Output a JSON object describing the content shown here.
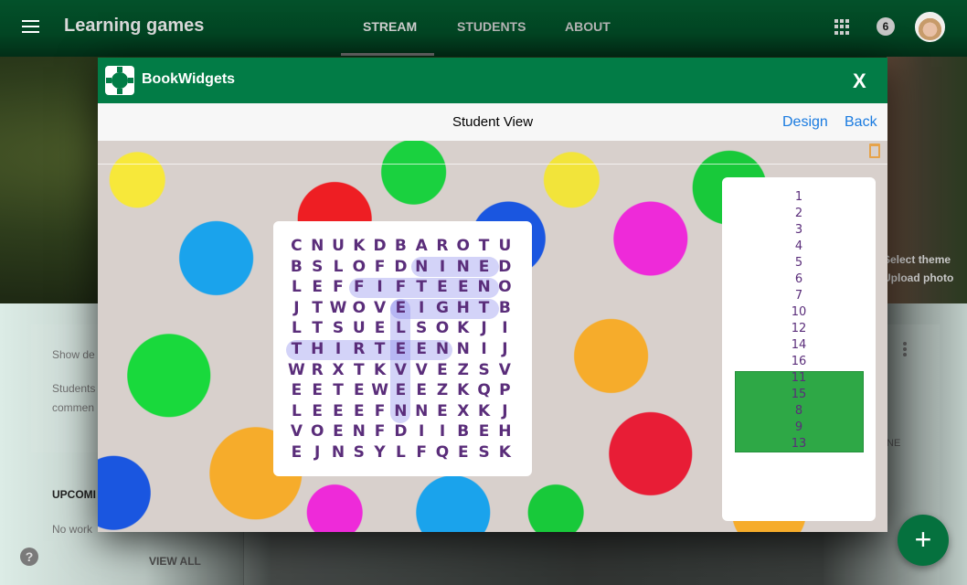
{
  "topbar": {
    "title": "Learning games",
    "tabs": [
      {
        "label": "STREAM",
        "active": true
      },
      {
        "label": "STUDENTS",
        "active": false
      },
      {
        "label": "ABOUT",
        "active": false
      }
    ],
    "notification_count": "6",
    "icons": {
      "menu": "hamburger-icon",
      "apps": "apps-grid-icon",
      "account": "avatar"
    }
  },
  "hero": {
    "select_theme": "Select theme",
    "upload_photo": "Upload photo"
  },
  "sidebar": {
    "show_deleted": "Show de",
    "students_line1": "Students",
    "students_line2": "commen",
    "upcoming_title": "UPCOMI",
    "no_work": "No work",
    "view_all": "VIEW ALL"
  },
  "stream": {
    "ne_label": "NE",
    "fab_label": "+"
  },
  "help": {
    "label": "?"
  },
  "modal": {
    "brand": "BookWidgets",
    "close_label": "X",
    "subbar_title": "Student View",
    "design_link": "Design",
    "back_link": "Back",
    "accent_color": "#027c46",
    "found_color": "#2ea846",
    "letter_color": "#5a2d7a"
  },
  "word_search": {
    "rows": [
      [
        "C",
        "N",
        "U",
        "K",
        "D",
        "B",
        "A",
        "R",
        "O",
        "T",
        "U"
      ],
      [
        "B",
        "S",
        "L",
        "O",
        "F",
        "D",
        "N",
        "I",
        "N",
        "E",
        "D"
      ],
      [
        "L",
        "E",
        "F",
        "F",
        "I",
        "F",
        "T",
        "E",
        "E",
        "N",
        "O"
      ],
      [
        "J",
        "T",
        "W",
        "O",
        "V",
        "E",
        "I",
        "G",
        "H",
        "T",
        "B"
      ],
      [
        "L",
        "T",
        "S",
        "U",
        "E",
        "L",
        "S",
        "O",
        "K",
        "J",
        "I"
      ],
      [
        "T",
        "H",
        "I",
        "R",
        "T",
        "E",
        "E",
        "N",
        "N",
        "I",
        "J"
      ],
      [
        "W",
        "R",
        "X",
        "T",
        "K",
        "V",
        "V",
        "E",
        "Z",
        "S",
        "V"
      ],
      [
        "E",
        "E",
        "T",
        "E",
        "W",
        "E",
        "E",
        "Z",
        "K",
        "Q",
        "P"
      ],
      [
        "L",
        "E",
        "E",
        "E",
        "F",
        "N",
        "N",
        "E",
        "X",
        "K",
        "J"
      ],
      [
        "V",
        "O",
        "E",
        "N",
        "F",
        "D",
        "I",
        "I",
        "B",
        "E",
        "H"
      ],
      [
        "E",
        "J",
        "N",
        "S",
        "Y",
        "L",
        "F",
        "Q",
        "E",
        "S",
        "K"
      ]
    ],
    "found_words": [
      "NINE",
      "FIFTEEN",
      "EIGHT",
      "THIRTEEN",
      "ELEVEN"
    ]
  },
  "number_list": {
    "remaining": [
      "1",
      "2",
      "3",
      "4",
      "5",
      "6",
      "7",
      "10",
      "12",
      "14",
      "16"
    ],
    "found": [
      "11",
      "15",
      "8",
      "9",
      "13"
    ]
  }
}
